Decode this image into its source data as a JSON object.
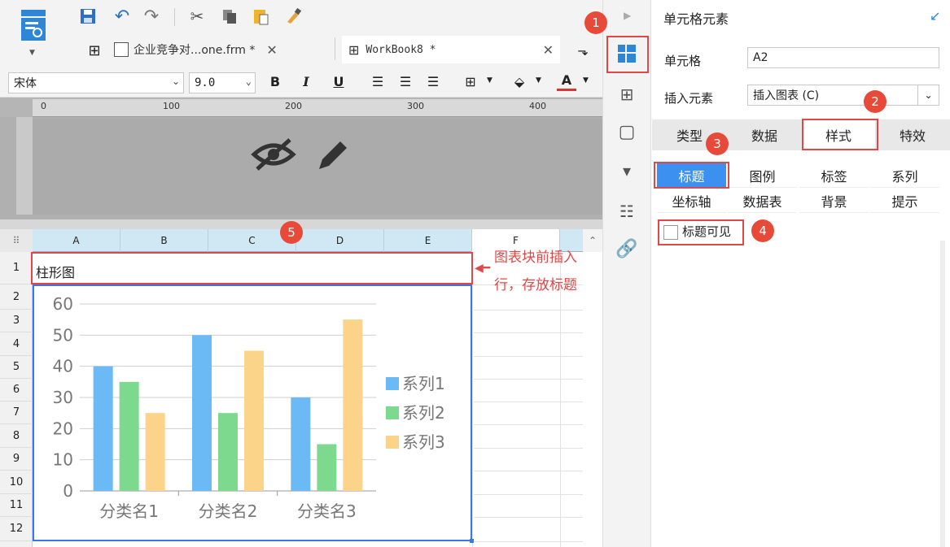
{
  "toolbar": {
    "tabs": [
      {
        "label": "企业竞争对...one.frm *"
      },
      {
        "label": "WorkBook8 *"
      }
    ]
  },
  "format": {
    "font": "宋体",
    "size": "9.0",
    "bold": "B",
    "italic": "I",
    "underline": "U",
    "font_color": "A"
  },
  "ruler": {
    "marks": [
      "0",
      "100",
      "200",
      "300",
      "400"
    ]
  },
  "sheet": {
    "columns": [
      "A",
      "B",
      "C",
      "D",
      "E",
      "F"
    ],
    "rows": [
      "1",
      "2",
      "3",
      "4",
      "5",
      "6",
      "7",
      "8",
      "9",
      "10",
      "11",
      "12"
    ],
    "cell_a1": "柱形图"
  },
  "annotation_note": "图表块前插入行，存放标题",
  "badges": [
    "1",
    "2",
    "3",
    "4",
    "5"
  ],
  "chart_data": {
    "type": "bar",
    "categories": [
      "分类名1",
      "分类名2",
      "分类名3"
    ],
    "series": [
      {
        "name": "系列1",
        "values": [
          40,
          50,
          30
        ],
        "color": "#6bb9f5"
      },
      {
        "name": "系列2",
        "values": [
          35,
          25,
          15
        ],
        "color": "#7cd98d"
      },
      {
        "name": "系列3",
        "values": [
          25,
          45,
          55
        ],
        "color": "#fbd389"
      }
    ],
    "ylim": [
      0,
      60
    ],
    "yticks": [
      "0",
      "10",
      "20",
      "30",
      "40",
      "50",
      "60"
    ],
    "grid": true,
    "legend": "right"
  },
  "panel": {
    "title": "单元格元素",
    "cell_label": "单元格",
    "cell_value": "A2",
    "insert_label": "插入元素",
    "insert_value": "插入图表 (C)",
    "tabs": [
      "类型",
      "数据",
      "样式",
      "特效"
    ],
    "subtabs": [
      "标题",
      "图例",
      "标签",
      "系列",
      "坐标轴",
      "数据表",
      "背景",
      "提示"
    ],
    "title_visible_label": "标题可见"
  },
  "colors": {
    "accent": "#3b78e7",
    "callout": "#e04848"
  }
}
